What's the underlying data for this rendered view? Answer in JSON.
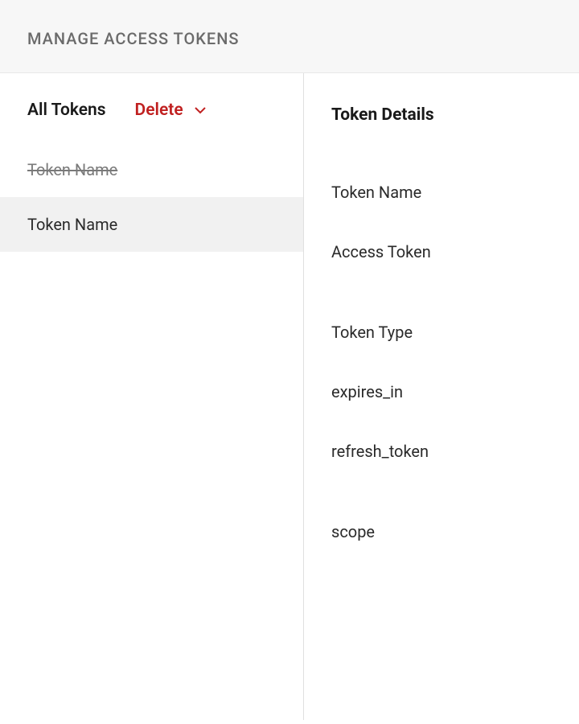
{
  "header": {
    "title": "MANAGE ACCESS TOKENS"
  },
  "sidebar": {
    "title": "All Tokens",
    "delete_label": "Delete",
    "items": [
      {
        "label": "Token Name",
        "deleted": true,
        "selected": false
      },
      {
        "label": "Token Name",
        "deleted": false,
        "selected": true
      }
    ]
  },
  "details": {
    "title": "Token Details",
    "fields": [
      {
        "label": "Token Name"
      },
      {
        "label": "Access Token"
      },
      {
        "label": "Token Type"
      },
      {
        "label": "expires_in"
      },
      {
        "label": "refresh_token"
      },
      {
        "label": "scope"
      }
    ]
  }
}
